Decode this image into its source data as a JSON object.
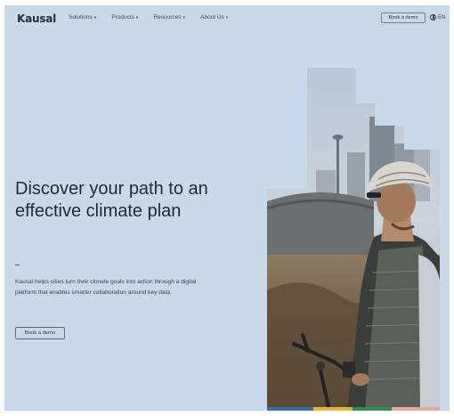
{
  "nav": {
    "logo": "Kausal",
    "menu": [
      {
        "label": "Solutions"
      },
      {
        "label": "Products"
      },
      {
        "label": "Resources"
      },
      {
        "label": "About Us"
      }
    ],
    "demo_button": "Book a demo",
    "language": "EN"
  },
  "hero": {
    "headline": "Discover your path to an effective climate plan",
    "body": "Kausal helps cities turn their climate goals into action through a digital platform that enables smarter collaboration around key data.",
    "cta": "Book a demo"
  },
  "colors": {
    "background": "#c9d9ec",
    "text": "#1c2a3a",
    "bars": [
      "#3a6fa8",
      "#e2b437",
      "#2f8a55",
      "#e7a8a3"
    ]
  }
}
